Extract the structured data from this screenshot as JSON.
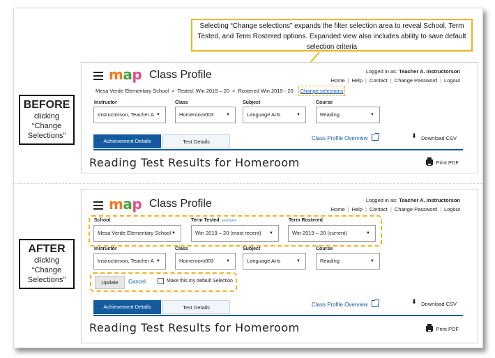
{
  "callout": {
    "text": "Selecting “Change selections” expands the filter selection area to reveal School, Term Tested, and Term Rostered options.  Expanded view also includes ability to save default selection criteria"
  },
  "labels": {
    "before": {
      "big": "BEFORE",
      "l1": "clicking",
      "l2": "“Change",
      "l3": "Selections”"
    },
    "after": {
      "big": "AFTER",
      "l1": "clicking",
      "l2": "“Change",
      "l3": "Selections”"
    }
  },
  "header": {
    "logo": {
      "p1": "m",
      "p2": "a",
      "p3": "p"
    },
    "title": "Class Profile",
    "logged_prefix": "Logged in as:",
    "logged_user": "Teacher A. Instructorson",
    "links": [
      "Home",
      "Help",
      "Contact",
      "Change Password",
      "Logout"
    ]
  },
  "breadcrumb": {
    "school": "Mesa Verde Elementary School",
    "tested": "Tested: Win 2019 – 20",
    "rostered": "Rostered Win 2019 - 20",
    "sep": ">",
    "change": "Change selections"
  },
  "filters": {
    "instructor": {
      "label": "Instructor",
      "value": "Instructorson, Teacher A"
    },
    "class": {
      "label": "Class",
      "value": "Homeroom003"
    },
    "subject": {
      "label": "Subject",
      "value": "Language Arts"
    },
    "course": {
      "label": "Course",
      "value": "Reading"
    }
  },
  "expanded": {
    "school": {
      "label": "School",
      "value": "Mesa Verde Elementary School"
    },
    "term_tested": {
      "label": "Term Tested",
      "examples": "Examples",
      "value": "Win 2019 – 20 (most recent)"
    },
    "term_rostered": {
      "label": "Term Rostered",
      "value": "Win 2019 – 20 (current)"
    },
    "update": "Update",
    "cancel": "Cancel",
    "default_label": "Make this my default Selection"
  },
  "tabs": [
    "Achievement Details",
    "Test Details"
  ],
  "overview_link": "Class Profile Overview",
  "download": "Download CSV",
  "results_title": "Reading Test Results for Homeroom",
  "print": "Print PDF",
  "colors": {
    "accent": "#145a9e",
    "highlight": "#f0b323",
    "link": "#1a5aa8"
  },
  "icons": [
    "hamburger-icon",
    "external-link-icon",
    "download-icon",
    "printer-icon",
    "caret-down-icon",
    "arrow-icon"
  ]
}
